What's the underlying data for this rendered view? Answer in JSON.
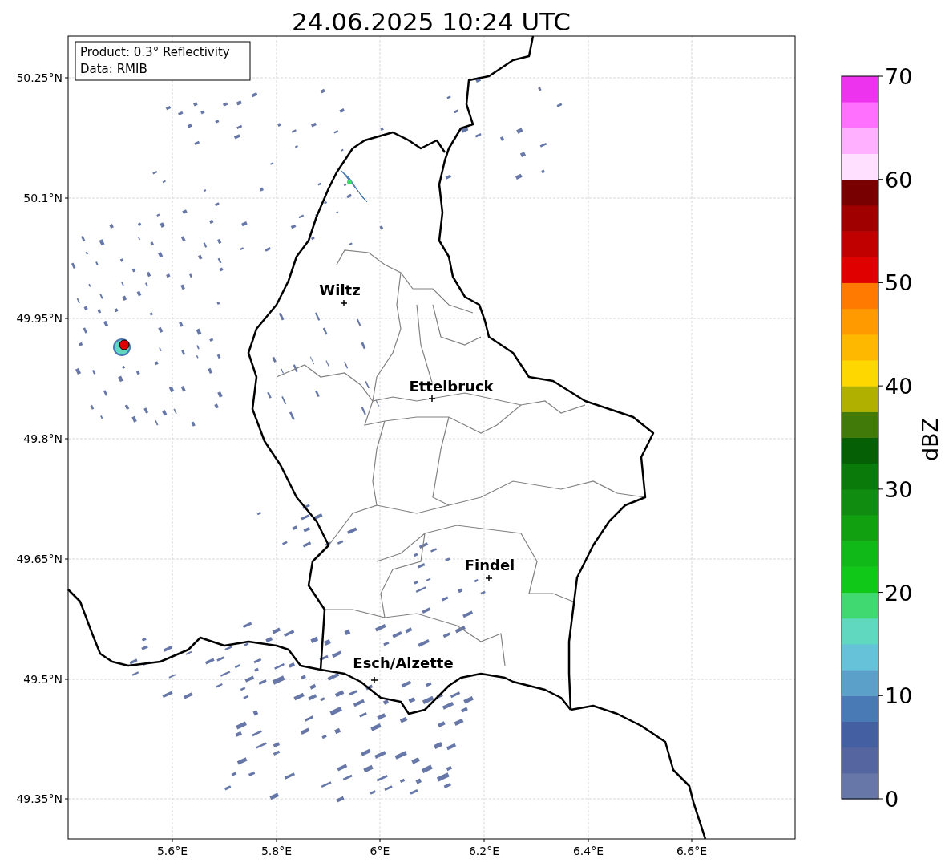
{
  "title": "24.06.2025 10:24 UTC",
  "info_box": {
    "lines": [
      "Product: 0.3° Reflectivity",
      "Data: RMIB"
    ]
  },
  "map": {
    "lat_labels": [
      "50.25°N",
      "50.1°N",
      "49.95°N",
      "49.8°N",
      "49.65°N",
      "49.5°N",
      "49.35°N"
    ],
    "lon_labels": [
      "5.6°E",
      "5.8°E",
      "6°E",
      "6.2°E",
      "6.4°E",
      "6.6°E"
    ],
    "cities": [
      {
        "name": "Wiltz"
      },
      {
        "name": "Ettelbruck"
      },
      {
        "name": "Findel"
      },
      {
        "name": "Esch/Alzette"
      }
    ]
  },
  "colorbar": {
    "label": "dBZ",
    "ticks": [
      "70",
      "60",
      "50",
      "40",
      "30",
      "20",
      "10",
      "0"
    ],
    "levels": [
      {
        "color": "#6677a8"
      },
      {
        "color": "#5565a0"
      },
      {
        "color": "#4560a2"
      },
      {
        "color": "#4a7ab5"
      },
      {
        "color": "#5aa0c8"
      },
      {
        "color": "#65c2d8"
      },
      {
        "color": "#60d8c0"
      },
      {
        "color": "#40d870"
      },
      {
        "color": "#10c818"
      },
      {
        "color": "#10b818"
      },
      {
        "color": "#10a010"
      },
      {
        "color": "#108c10"
      },
      {
        "color": "#0a7a0a"
      },
      {
        "color": "#056005"
      },
      {
        "color": "#427a0a"
      },
      {
        "color": "#b0b000"
      },
      {
        "color": "#ffd700"
      },
      {
        "color": "#ffb800"
      },
      {
        "color": "#ff9a00"
      },
      {
        "color": "#ff7a00"
      },
      {
        "color": "#e00000"
      },
      {
        "color": "#c00000"
      },
      {
        "color": "#a00000"
      },
      {
        "color": "#780000"
      },
      {
        "color": "#ffe0ff"
      },
      {
        "color": "#ffb0ff"
      },
      {
        "color": "#ff70ff"
      },
      {
        "color": "#ee33ee"
      }
    ]
  }
}
